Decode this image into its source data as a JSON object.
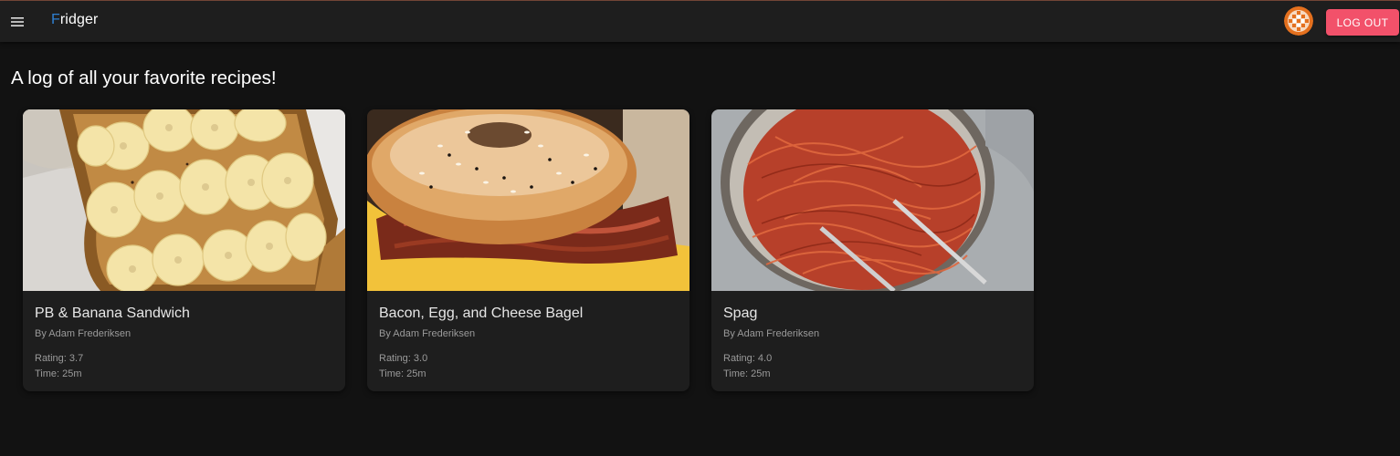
{
  "header": {
    "brand_first": "F",
    "brand_rest": "ridger",
    "menu_icon": "hamburger-menu-icon",
    "avatar_icon": "user-avatar-icon",
    "logout_label": "LOG OUT",
    "accent_color": "#2e7fd1",
    "logout_color": "#f2516a"
  },
  "page": {
    "title": "A log of all your favorite recipes!"
  },
  "recipes": [
    {
      "title": "PB & Banana Sandwich",
      "author": "By Adam Frederiksen",
      "rating": "Rating: 3.7",
      "time": "Time: 25m",
      "image": "pb-banana-toast-image"
    },
    {
      "title": "Bacon, Egg, and Cheese Bagel",
      "author": "By Adam Frederiksen",
      "rating": "Rating: 3.0",
      "time": "Time: 25m",
      "image": "bagel-sandwich-image"
    },
    {
      "title": "Spag",
      "author": "By Adam Frederiksen",
      "rating": "Rating: 4.0",
      "time": "Time: 25m",
      "image": "spaghetti-pan-image"
    }
  ]
}
